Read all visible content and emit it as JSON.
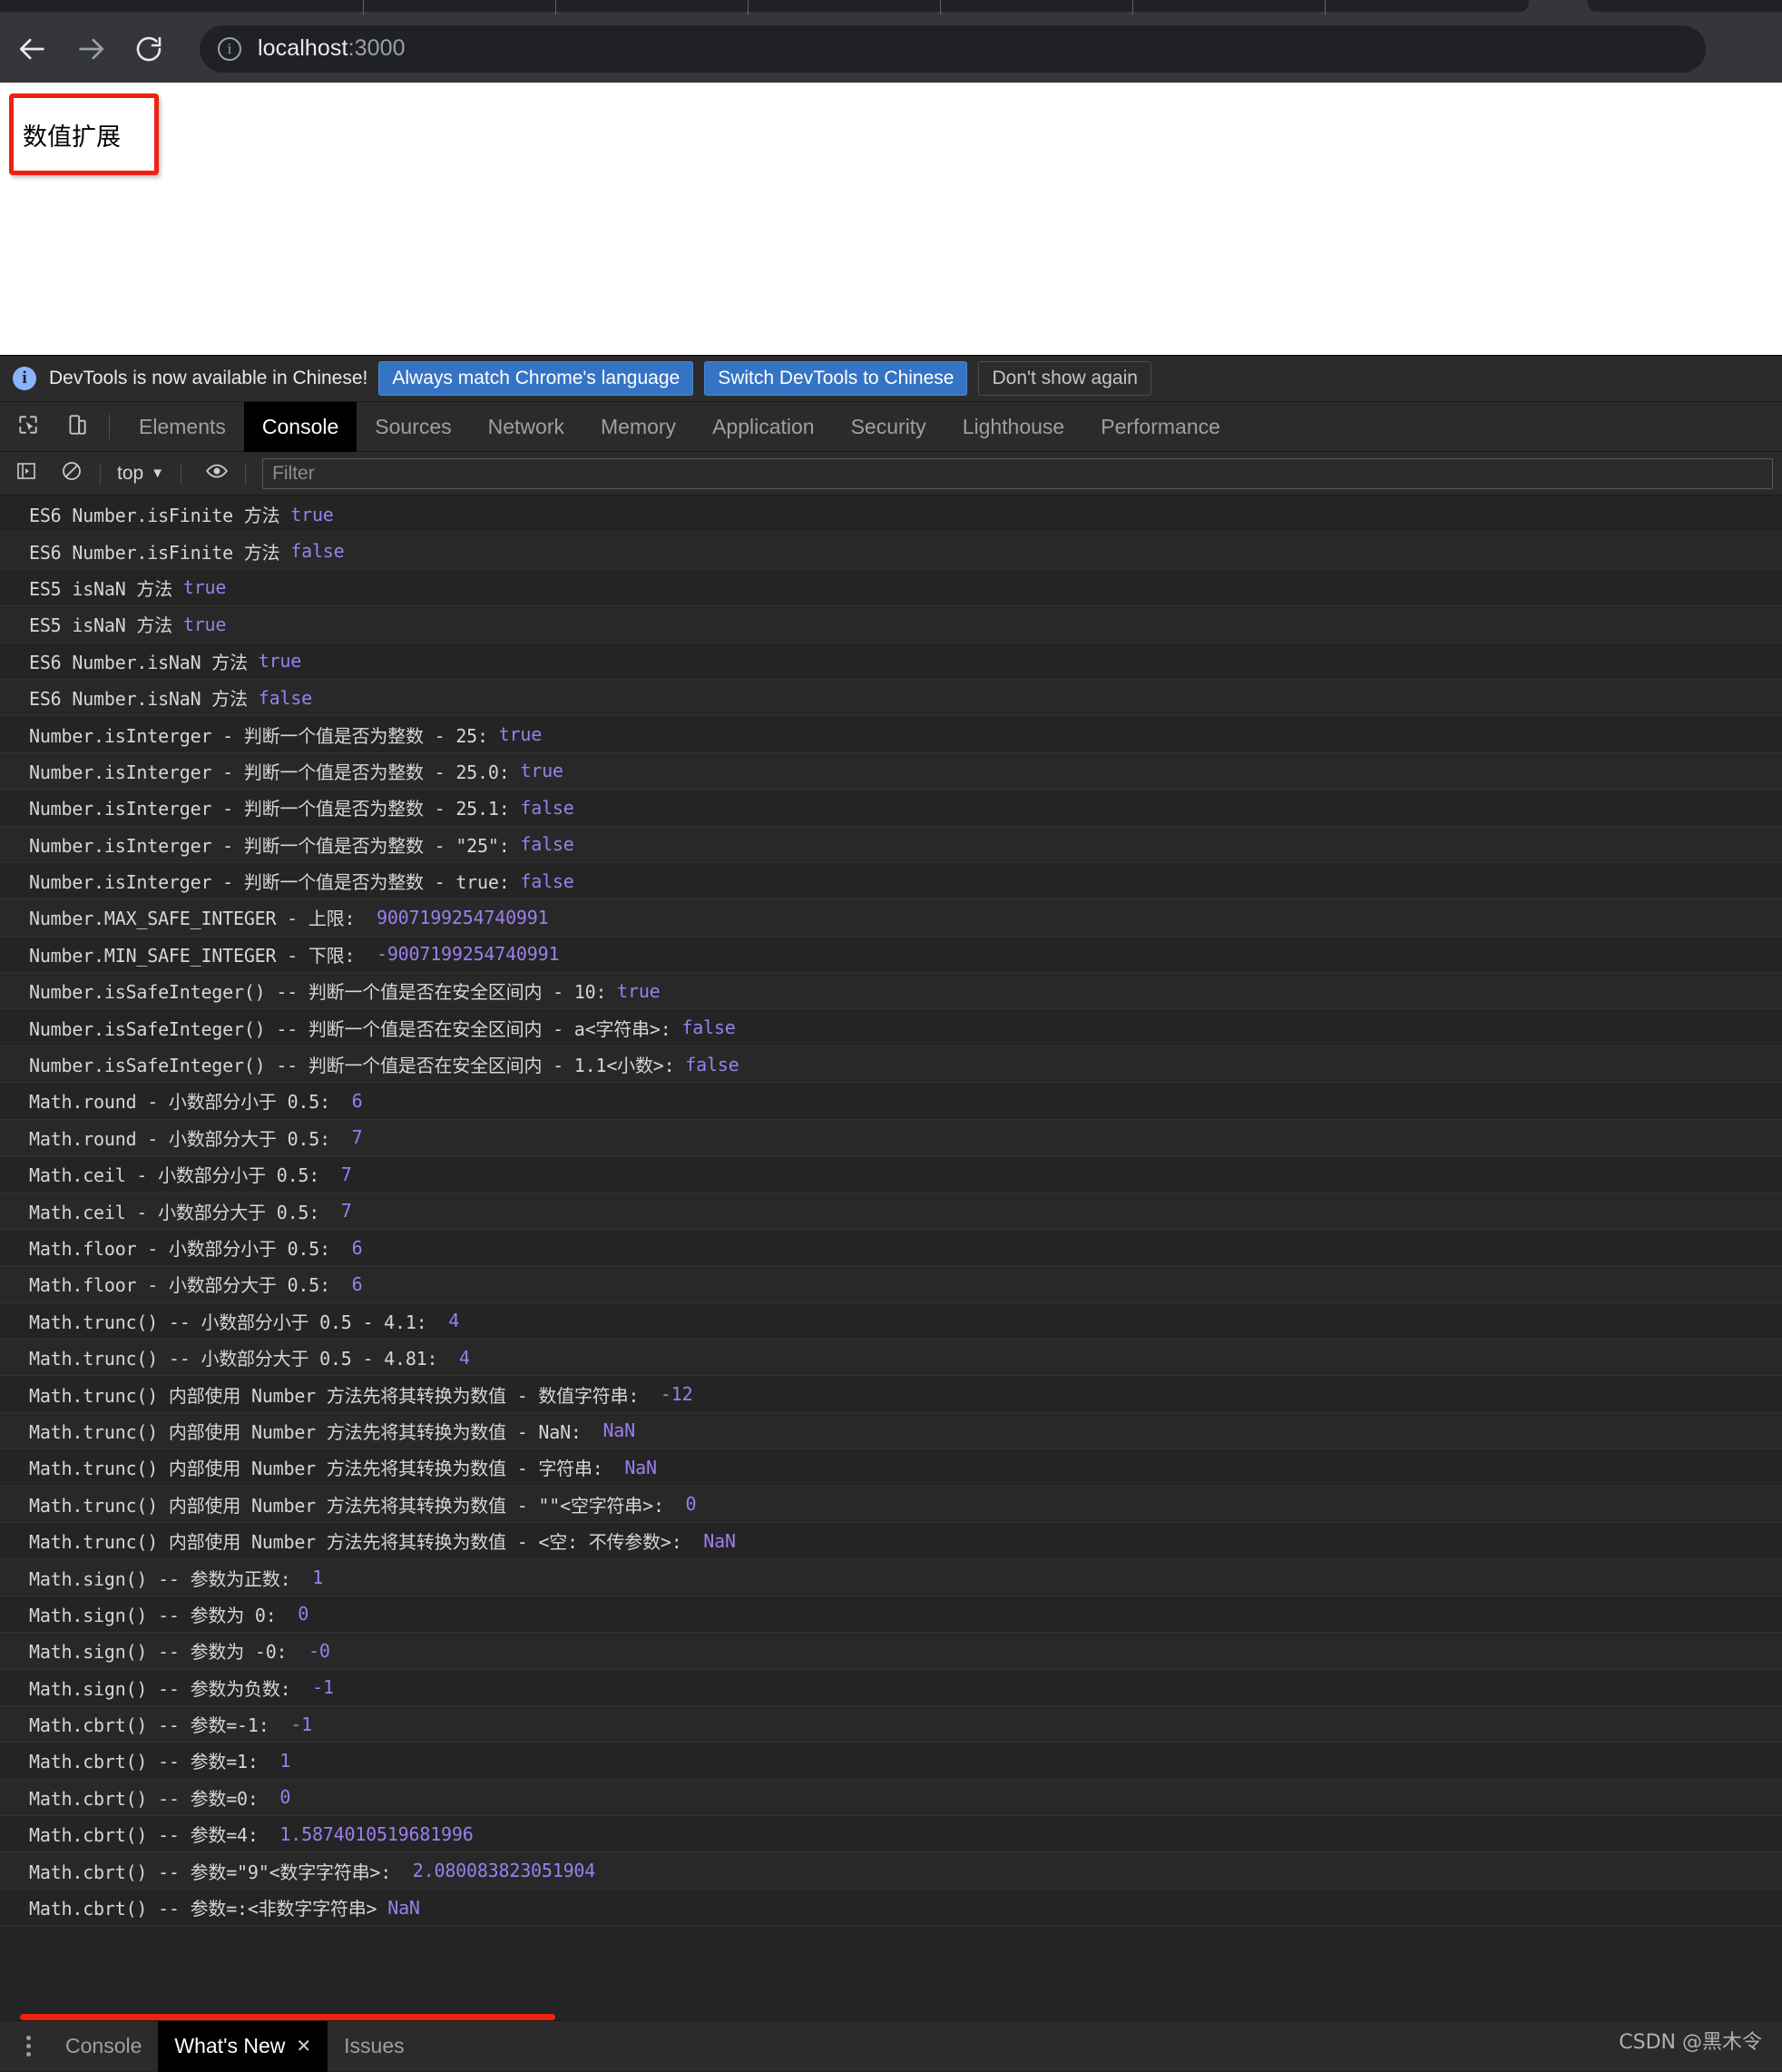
{
  "browser": {
    "back_icon": "back-arrow-icon",
    "forward_icon": "forward-arrow-icon",
    "reload_icon": "reload-icon",
    "site_info_icon": "info-icon",
    "url_host": "localhost",
    "url_port": ":3000"
  },
  "page": {
    "box_label": "数值扩展"
  },
  "devtools": {
    "infobar": {
      "icon": "info-circle-icon",
      "message": "DevTools is now available in Chinese!",
      "buttons": [
        {
          "label": "Always match Chrome's language",
          "style": "primary"
        },
        {
          "label": "Switch DevTools to Chinese",
          "style": "primary"
        },
        {
          "label": "Don't show again",
          "style": "ghost"
        }
      ]
    },
    "tabbar": {
      "inspect_icon": "inspect-element-icon",
      "device_icon": "device-toolbar-icon",
      "tabs": [
        {
          "label": "Elements",
          "selected": false
        },
        {
          "label": "Console",
          "selected": true
        },
        {
          "label": "Sources",
          "selected": false
        },
        {
          "label": "Network",
          "selected": false
        },
        {
          "label": "Memory",
          "selected": false
        },
        {
          "label": "Application",
          "selected": false
        },
        {
          "label": "Security",
          "selected": false
        },
        {
          "label": "Lighthouse",
          "selected": false
        },
        {
          "label": "Performance",
          "selected": false
        }
      ]
    },
    "console_toolbar": {
      "sidebar_icon": "console-sidebar-icon",
      "clear_icon": "clear-console-icon",
      "context": "top",
      "context_caret": "▼",
      "eye_icon": "live-expression-icon",
      "filter_placeholder": "Filter",
      "filter_value": ""
    },
    "messages": [
      {
        "text": "ES6 Number.isFinite 方法 ",
        "value": "true"
      },
      {
        "text": "ES6 Number.isFinite 方法 ",
        "value": "false"
      },
      {
        "text": "ES5 isNaN 方法 ",
        "value": "true"
      },
      {
        "text": "ES5 isNaN 方法 ",
        "value": "true"
      },
      {
        "text": "ES6 Number.isNaN 方法 ",
        "value": "true"
      },
      {
        "text": "ES6 Number.isNaN 方法 ",
        "value": "false"
      },
      {
        "text": "Number.isInterger - 判断一个值是否为整数 - 25: ",
        "value": "true"
      },
      {
        "text": "Number.isInterger - 判断一个值是否为整数 - 25.0: ",
        "value": "true"
      },
      {
        "text": "Number.isInterger - 判断一个值是否为整数 - 25.1: ",
        "value": "false"
      },
      {
        "text": "Number.isInterger - 判断一个值是否为整数 - \"25\": ",
        "value": "false"
      },
      {
        "text": "Number.isInterger - 判断一个值是否为整数 - true: ",
        "value": "false"
      },
      {
        "text": "Number.MAX_SAFE_INTEGER - 上限:  ",
        "value": "9007199254740991"
      },
      {
        "text": "Number.MIN_SAFE_INTEGER - 下限:  ",
        "value": "-9007199254740991"
      },
      {
        "text": "Number.isSafeInteger() -- 判断一个值是否在安全区间内 - 10: ",
        "value": "true"
      },
      {
        "text": "Number.isSafeInteger() -- 判断一个值是否在安全区间内 - a<字符串>: ",
        "value": "false"
      },
      {
        "text": "Number.isSafeInteger() -- 判断一个值是否在安全区间内 - 1.1<小数>: ",
        "value": "false"
      },
      {
        "text": "Math.round - 小数部分小于 0.5:  ",
        "value": "6"
      },
      {
        "text": "Math.round - 小数部分大于 0.5:  ",
        "value": "7"
      },
      {
        "text": "Math.ceil - 小数部分小于 0.5:  ",
        "value": "7"
      },
      {
        "text": "Math.ceil - 小数部分大于 0.5:  ",
        "value": "7"
      },
      {
        "text": "Math.floor - 小数部分小于 0.5:  ",
        "value": "6"
      },
      {
        "text": "Math.floor - 小数部分大于 0.5:  ",
        "value": "6"
      },
      {
        "text": "Math.trunc() -- 小数部分小于 0.5 - 4.1:  ",
        "value": "4"
      },
      {
        "text": "Math.trunc() -- 小数部分大于 0.5 - 4.81:  ",
        "value": "4"
      },
      {
        "text": "Math.trunc() 内部使用 Number 方法先将其转换为数值 - 数值字符串:  ",
        "value": "-12"
      },
      {
        "text": "Math.trunc() 内部使用 Number 方法先将其转换为数值 - NaN:  ",
        "value": "NaN"
      },
      {
        "text": "Math.trunc() 内部使用 Number 方法先将其转换为数值 - 字符串:  ",
        "value": "NaN"
      },
      {
        "text": "Math.trunc() 内部使用 Number 方法先将其转换为数值 - \"\"<空字符串>:  ",
        "value": "0"
      },
      {
        "text": "Math.trunc() 内部使用 Number 方法先将其转换为数值 - <空: 不传参数>:  ",
        "value": "NaN"
      },
      {
        "text": "Math.sign() -- 参数为正数:  ",
        "value": "1"
      },
      {
        "text": "Math.sign() -- 参数为 0:  ",
        "value": "0"
      },
      {
        "text": "Math.sign() -- 参数为 -0:  ",
        "value": "-0"
      },
      {
        "text": "Math.sign() -- 参数为负数:  ",
        "value": "-1"
      },
      {
        "text": "Math.cbrt() -- 参数=-1:  ",
        "value": "-1"
      },
      {
        "text": "Math.cbrt() -- 参数=1:  ",
        "value": "1"
      },
      {
        "text": "Math.cbrt() -- 参数=0:  ",
        "value": "0"
      },
      {
        "text": "Math.cbrt() -- 参数=4:  ",
        "value": "1.5874010519681996"
      },
      {
        "text": "Math.cbrt() -- 参数=\"9\"<数字字符串>:  ",
        "value": "2.080083823051904"
      },
      {
        "text": "Math.cbrt() -- 参数=:<非数字字符串> ",
        "value": "NaN"
      }
    ],
    "prompt_caret": "❯",
    "drawer": {
      "more_icon": "kebab-menu-icon",
      "tabs": [
        {
          "label": "Console",
          "selected": false,
          "closable": false
        },
        {
          "label": "What's New",
          "selected": true,
          "closable": true,
          "close_glyph": "✕"
        },
        {
          "label": "Issues",
          "selected": false,
          "closable": false
        }
      ]
    }
  },
  "watermark": "CSDN @黑木令",
  "colors": {
    "devtools_bg": "#242424",
    "panel_bg": "#2b2b2b",
    "accent_blue": "#3574c4",
    "value_purple": "#9a7fee",
    "highlight_red": "#ee2211"
  }
}
